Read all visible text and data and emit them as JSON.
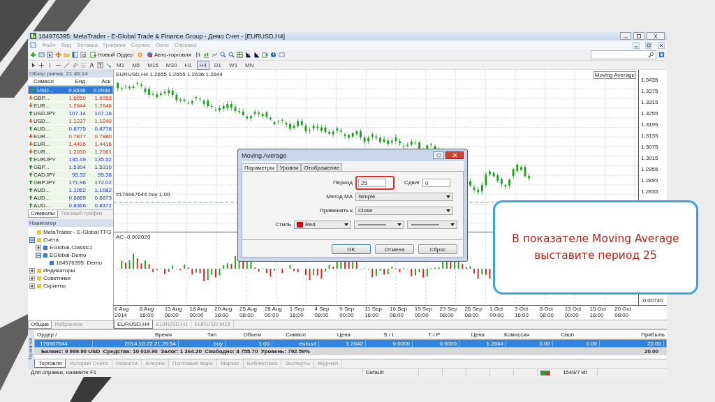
{
  "window": {
    "title": "184976395: MetaTrader - E-Global Trade & Finance Group - Демо Счет - [EURUSD,H4]"
  },
  "menu": [
    {
      "label": "Файл",
      "disabled": true
    },
    {
      "label": "Вид",
      "disabled": true
    },
    {
      "label": "Вставка",
      "disabled": true
    },
    {
      "label": "Графики",
      "disabled": true
    },
    {
      "label": "Сервис",
      "disabled": true
    },
    {
      "label": "Окно",
      "disabled": true
    },
    {
      "label": "Справка",
      "disabled": true
    }
  ],
  "toolbar": {
    "buttons": [
      "Новый Ордер",
      "Авто-торговля"
    ]
  },
  "timeframes": [
    {
      "label": "M1",
      "selected": false
    },
    {
      "label": "M5",
      "selected": false
    },
    {
      "label": "M15",
      "selected": false
    },
    {
      "label": "M30",
      "selected": false
    },
    {
      "label": "H1",
      "selected": false
    },
    {
      "label": "H4",
      "selected": true
    },
    {
      "label": "D1",
      "selected": false
    },
    {
      "label": "W1",
      "selected": false
    },
    {
      "label": "MN",
      "selected": false
    }
  ],
  "market_watch": {
    "title": "Обзор рынка: 21:46:14",
    "columns": [
      "Символ",
      "Бид",
      "Аск"
    ],
    "rows": [
      {
        "symbol": "USD...",
        "bid": "0.9536",
        "ask": "0.9538",
        "rising": true,
        "selected": true
      },
      {
        "symbol": "GBP...",
        "bid": "1.6050",
        "ask": "1.6053",
        "rising": false,
        "selected": false
      },
      {
        "symbol": "EUR...",
        "bid": "1.2644",
        "ask": "1.2646",
        "rising": false,
        "selected": false
      },
      {
        "symbol": "USDJPY",
        "bid": "107.14",
        "ask": "107.16",
        "rising": true,
        "selected": false
      },
      {
        "symbol": "USD...",
        "bid": "1.1237",
        "ask": "1.1240",
        "rising": false,
        "selected": false
      },
      {
        "symbol": "AUD...",
        "bid": "0.8775",
        "ask": "0.8778",
        "rising": true,
        "selected": false
      },
      {
        "symbol": "EUR...",
        "bid": "0.7877",
        "ask": "0.7880",
        "rising": false,
        "selected": false
      },
      {
        "symbol": "EUR...",
        "bid": "1.4406",
        "ask": "1.4416",
        "rising": false,
        "selected": false
      },
      {
        "symbol": "EUR...",
        "bid": "1.2050",
        "ask": "1.2061",
        "rising": false,
        "selected": false
      },
      {
        "symbol": "EURJPY",
        "bid": "135.49",
        "ask": "135.52",
        "rising": true,
        "selected": false
      },
      {
        "symbol": "GBP...",
        "bid": "1.5304",
        "ask": "1.5310",
        "rising": true,
        "selected": false
      },
      {
        "symbol": "CADJPY",
        "bid": "95.32",
        "ask": "95.38",
        "rising": true,
        "selected": false
      },
      {
        "symbol": "GBPJPY",
        "bid": "171.96",
        "ask": "172.02",
        "rising": true,
        "selected": false
      },
      {
        "symbol": "AUD...",
        "bid": "1.1062",
        "ask": "1.1082",
        "rising": true,
        "selected": false
      },
      {
        "symbol": "AUD...",
        "bid": "0.8865",
        "ask": "0.8873",
        "rising": true,
        "selected": false
      },
      {
        "symbol": "AUD...",
        "bid": "0.8366",
        "ask": "0.8372",
        "rising": true,
        "selected": false
      }
    ],
    "tabs": [
      {
        "label": "Символы",
        "selected": true
      },
      {
        "label": "Тиковый график",
        "selected": false
      }
    ]
  },
  "navigator": {
    "title": "Навигатор",
    "tree": [
      {
        "label": "MetaTrader - E-Global TFG"
      },
      {
        "label": "Счета",
        "expanded": true,
        "children": [
          {
            "label": "EGlobal-Classic1",
            "expanded": false
          },
          {
            "label": "EGlobal-Demo",
            "expanded": true,
            "children": [
              {
                "label": "184976395: Demo"
              }
            ]
          }
        ]
      },
      {
        "label": "Индикаторы",
        "expanded": false
      },
      {
        "label": "Советники",
        "expanded": false
      },
      {
        "label": "Скрипты",
        "expanded": false
      }
    ],
    "tabs": [
      {
        "label": "Общие",
        "selected": true
      },
      {
        "label": "Избранное",
        "selected": false
      }
    ]
  },
  "chart": {
    "header": "EURUSD,H4  1.2655 1.2655 1.2636 1.2644",
    "indicator_label": "Moving Average",
    "order_line": "#176967644 buy 1.00",
    "price_ticks": [
      "1.3435",
      "1.3375",
      "1.3315",
      "1.3255",
      "1.3195",
      "1.3135",
      "1.3075",
      "1.3015",
      "1.2955",
      "1.2895",
      "1.2835"
    ],
    "oscillator_label": "AC -0.002020",
    "oscillator_tick": "-0.00740",
    "time_ticks": [
      "6 Aug 2014",
      "8 Aug 16:00",
      "13 Aug 08:00",
      "18 Aug 00:00",
      "20 Aug 16:00",
      "25 Aug 08:00",
      "28 Aug 00:00",
      "1 Sep 16:00",
      "4 Sep 08:00",
      "9 Sep 00:00",
      "11 Sep 16:00",
      "16 Sep 08:00",
      "19 Sep 00:00",
      "23 Sep 08:00",
      "26 Sep 08:00",
      "1 Oct 00:00",
      "3 Oct 16:00",
      "8 Oct 08:00",
      "13 Oct 00:00",
      "15 Oct 16:00",
      "20 Oct 08:00"
    ]
  },
  "chart_tabs": [
    {
      "label": "EURUSD,H4",
      "selected": true
    },
    {
      "label": "EURUSD,H1",
      "selected": false
    },
    {
      "label": "EURUSD,M15",
      "selected": false
    }
  ],
  "dialog": {
    "title": "Moving Average",
    "tabs": [
      {
        "label": "Параметры",
        "selected": true
      },
      {
        "label": "Уровни",
        "selected": false
      },
      {
        "label": "Отображение",
        "selected": false
      }
    ],
    "period": {
      "label": "Период",
      "value": "25"
    },
    "shift": {
      "label": "Сдвиг",
      "value": "0"
    },
    "method": {
      "label": "Метод МА",
      "value": "Simple"
    },
    "apply": {
      "label": "Применить к",
      "value": "Close"
    },
    "style": {
      "label": "Стиль",
      "value": "Red",
      "color": "#e00000"
    },
    "buttons": [
      "OK",
      "Отмена",
      "Сброс"
    ]
  },
  "terminal": {
    "side_label": "Терминал",
    "columns": [
      "Ордер /",
      "Время",
      "Тип",
      "Объем",
      "Символ",
      "Цена",
      "S / L",
      "T / P",
      "Цена",
      "Комиссия",
      "Своп",
      "Прибыль"
    ],
    "rows": [
      {
        "cells": [
          "176967644",
          "2014.10.22 21:26:54",
          "buy",
          "1.00",
          "eurusd",
          "1.2642",
          "0.0000",
          "0.0000",
          "1.2644",
          "0.00",
          "0.00",
          "20.00"
        ],
        "selected": true
      }
    ],
    "balance": "Баланс: 9 999.90 USD  Средства: 10 019.90  Залог: 1 264.20  Свободно: 8 755.70  Уровень: 792.59%",
    "total": "20.00",
    "tabs": [
      {
        "label": "Торговля",
        "selected": true
      },
      {
        "label": "История Счета",
        "selected": false
      },
      {
        "label": "Новости",
        "selected": false
      },
      {
        "label": "Алерты",
        "selected": false
      },
      {
        "label": "Почтовый ящик",
        "selected": false
      },
      {
        "label": "Маркет",
        "selected": false
      },
      {
        "label": "Библиотека",
        "selected": false
      },
      {
        "label": "Эксперты",
        "selected": false
      },
      {
        "label": "Журнал",
        "selected": false
      }
    ]
  },
  "status_bar": [
    "Для справки, нажмите F1",
    "Default",
    "1549/7 kb"
  ],
  "callout": "В показателе Moving Average выставите период 25"
}
